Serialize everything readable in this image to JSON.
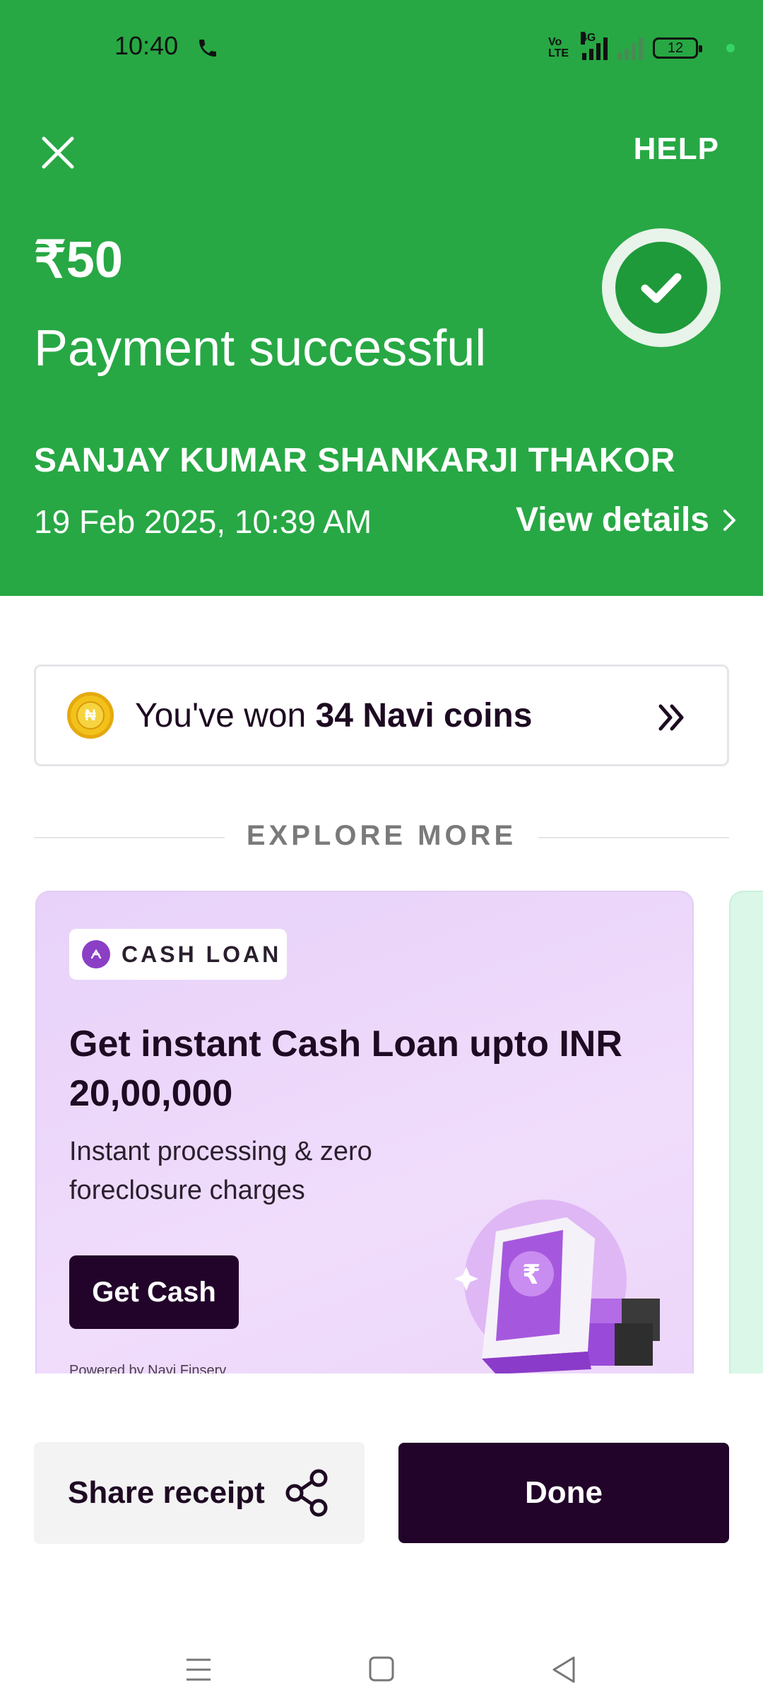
{
  "status_bar": {
    "time": "10:40",
    "network_label": "Vo LTE",
    "network_type": "4G",
    "battery": "12"
  },
  "header": {
    "close_icon": "close-icon",
    "help_label": "HELP",
    "amount": "₹50",
    "status_title": "Payment successful",
    "payee": "SANJAY KUMAR SHANKARJI THAKOR",
    "date_time": "19 Feb 2025, 10:39 AM",
    "view_details_label": "View details",
    "accent_color": "#27a844"
  },
  "coins": {
    "prefix": "You've won ",
    "highlight": "34 Navi coins"
  },
  "explore": {
    "label": "EXPLORE MORE"
  },
  "promo": {
    "tag_label": "CASH LOAN",
    "title": "Get instant Cash Loan upto INR 20,00,000",
    "subtitle": "Instant processing & zero foreclosure charges",
    "button_label": "Get Cash",
    "powered_by": "Powered by Navi Finserv"
  },
  "actions": {
    "share_label": "Share receipt",
    "done_label": "Done"
  }
}
